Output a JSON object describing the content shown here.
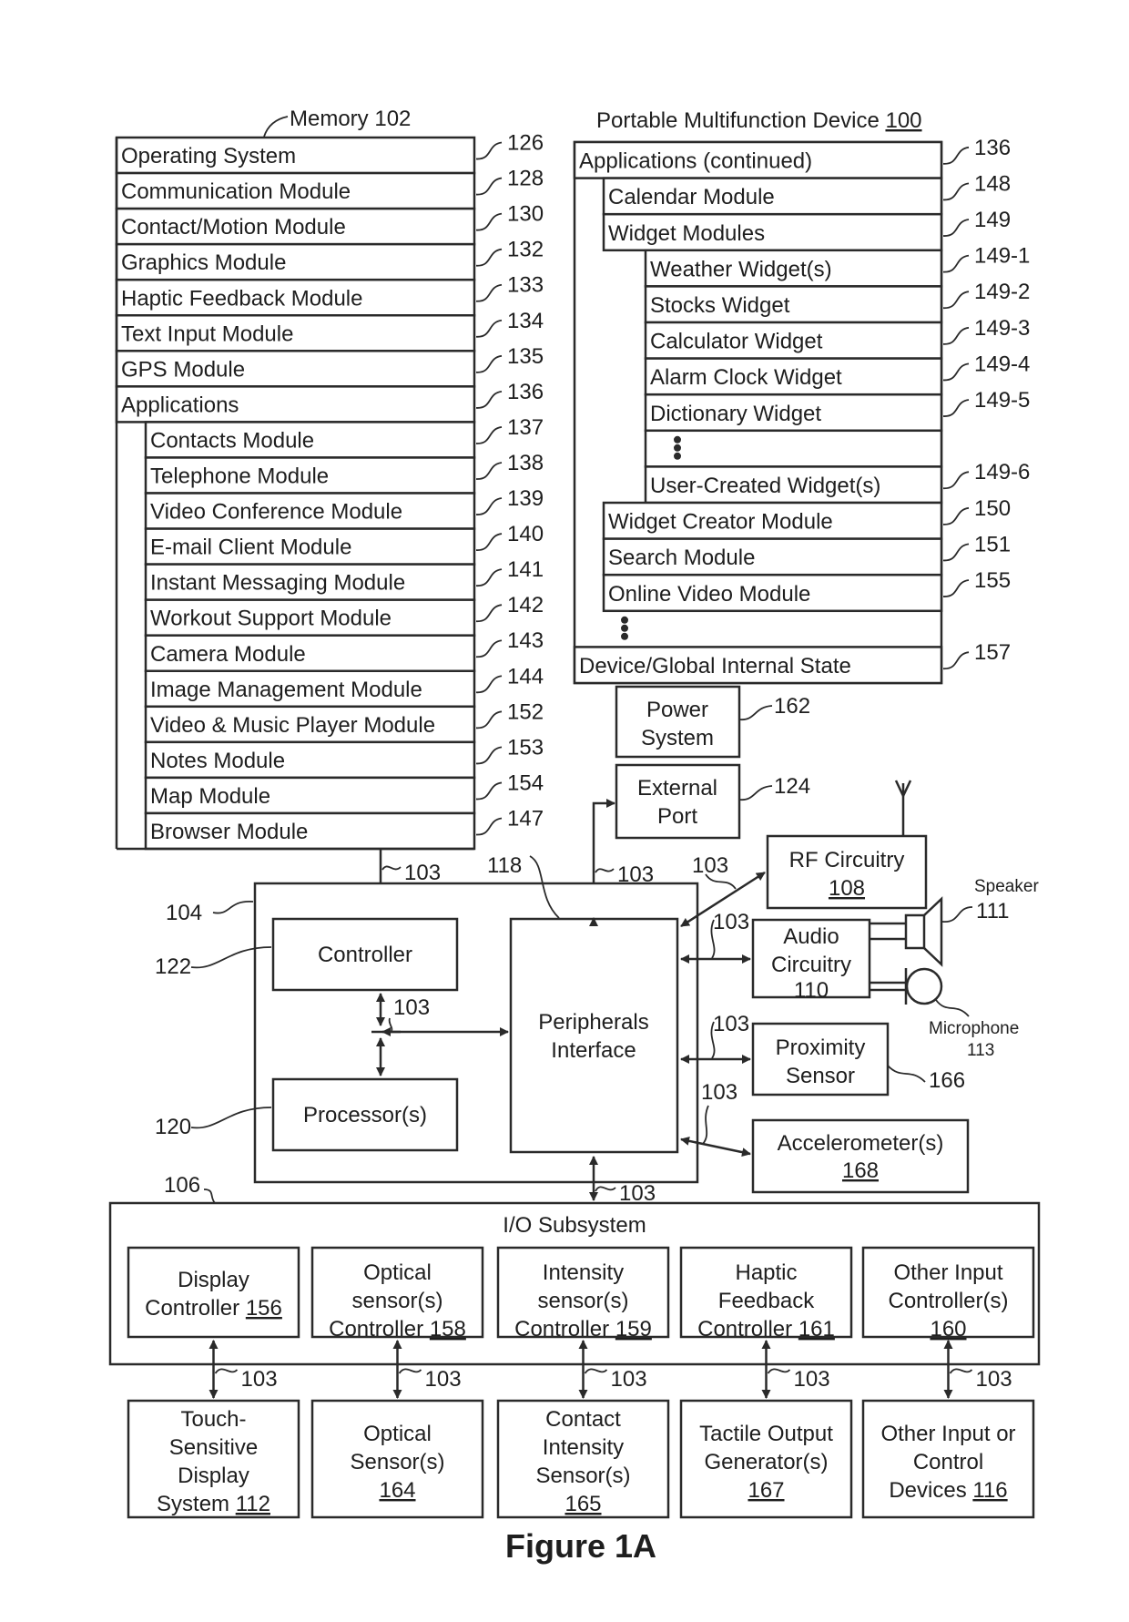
{
  "memory": {
    "label": "Memory 102",
    "rows": [
      {
        "text": "Operating System",
        "ref": "126",
        "indent": 0
      },
      {
        "text": "Communication Module",
        "ref": "128",
        "indent": 0
      },
      {
        "text": "Contact/Motion Module",
        "ref": "130",
        "indent": 0
      },
      {
        "text": "Graphics Module",
        "ref": "132",
        "indent": 0
      },
      {
        "text": "Haptic Feedback Module",
        "ref": "133",
        "indent": 0
      },
      {
        "text": "Text Input Module",
        "ref": "134",
        "indent": 0
      },
      {
        "text": "GPS Module",
        "ref": "135",
        "indent": 0
      },
      {
        "text": "Applications",
        "ref": "136",
        "indent": 0
      },
      {
        "text": "Contacts Module",
        "ref": "137",
        "indent": 1
      },
      {
        "text": "Telephone Module",
        "ref": "138",
        "indent": 1
      },
      {
        "text": "Video Conference Module",
        "ref": "139",
        "indent": 1
      },
      {
        "text": "E-mail Client Module",
        "ref": "140",
        "indent": 1
      },
      {
        "text": "Instant Messaging Module",
        "ref": "141",
        "indent": 1
      },
      {
        "text": "Workout Support Module",
        "ref": "142",
        "indent": 1
      },
      {
        "text": "Camera Module",
        "ref": "143",
        "indent": 1
      },
      {
        "text": "Image Management Module",
        "ref": "144",
        "indent": 1
      },
      {
        "text": "Video & Music Player Module",
        "ref": "152",
        "indent": 1
      },
      {
        "text": "Notes Module",
        "ref": "153",
        "indent": 1
      },
      {
        "text": "Map Module",
        "ref": "154",
        "indent": 1
      },
      {
        "text": "Browser Module",
        "ref": "147",
        "indent": 1
      }
    ]
  },
  "device": {
    "label_prefix": "Portable Multifunction Device ",
    "label_ref": "100",
    "rows": [
      {
        "text": "Applications (continued)",
        "ref": "136",
        "indent": 0
      },
      {
        "text": "Calendar Module",
        "ref": "148",
        "indent": 1
      },
      {
        "text": "Widget Modules",
        "ref": "149",
        "indent": 1
      },
      {
        "text": "Weather Widget(s)",
        "ref": "149-1",
        "indent": 2
      },
      {
        "text": "Stocks Widget",
        "ref": "149-2",
        "indent": 2
      },
      {
        "text": "Calculator Widget",
        "ref": "149-3",
        "indent": 2
      },
      {
        "text": "Alarm Clock Widget",
        "ref": "149-4",
        "indent": 2
      },
      {
        "text": "Dictionary Widget",
        "ref": "149-5",
        "indent": 2
      },
      {
        "text": "",
        "ref": "",
        "indent": 2,
        "ellipsis": true
      },
      {
        "text": "User-Created Widget(s)",
        "ref": "149-6",
        "indent": 2
      },
      {
        "text": "Widget Creator Module",
        "ref": "150",
        "indent": 1
      },
      {
        "text": "Search Module",
        "ref": "151",
        "indent": 1
      },
      {
        "text": "Online Video Module",
        "ref": "155",
        "indent": 1
      },
      {
        "text": "",
        "ref": "",
        "indent": 0,
        "ellipsis": true
      },
      {
        "text": "Device/Global Internal State",
        "ref": "157",
        "indent": 0
      }
    ]
  },
  "power": {
    "line1": "Power",
    "line2": "System",
    "ref": "162"
  },
  "external_port": {
    "line1": "External",
    "line2": "Port",
    "ref": "124"
  },
  "bus_ref": "103",
  "chip": {
    "ref": "104",
    "controller": {
      "text": "Controller",
      "ref": "122"
    },
    "processor": {
      "text": "Processor(s)",
      "ref": "120"
    },
    "peripherals": {
      "line1": "Peripherals",
      "line2": "Interface",
      "ref": "118"
    }
  },
  "rf": {
    "line1": "RF Circuitry",
    "ref": "108"
  },
  "audio": {
    "line1": "Audio",
    "line2": "Circuitry",
    "ref": "110"
  },
  "speaker": {
    "label": "Speaker",
    "ref": "111"
  },
  "microphone": {
    "label": "Microphone",
    "ref": "113"
  },
  "proximity": {
    "line1": "Proximity",
    "line2": "Sensor",
    "ref": "166"
  },
  "accelerometer": {
    "line1": "Accelerometer(s)",
    "ref": "168"
  },
  "io": {
    "label": "I/O Subsystem",
    "ref": "106",
    "controllers": [
      {
        "lines": [
          "Display",
          "Controller "
        ],
        "ref": "156"
      },
      {
        "lines": [
          "Optical",
          "sensor(s)",
          "Controller "
        ],
        "ref": "158"
      },
      {
        "lines": [
          "Intensity",
          "sensor(s)",
          "Controller "
        ],
        "ref": "159"
      },
      {
        "lines": [
          "Haptic",
          "Feedback",
          "Controller "
        ],
        "ref": "161"
      },
      {
        "lines": [
          "Other Input",
          "Controller(s)",
          ""
        ],
        "ref": "160"
      }
    ],
    "devices": [
      {
        "lines": [
          "Touch-",
          "Sensitive",
          "Display",
          "System "
        ],
        "ref": "112"
      },
      {
        "lines": [
          "Optical",
          "Sensor(s)",
          ""
        ],
        "ref": "164"
      },
      {
        "lines": [
          "Contact",
          "Intensity",
          "Sensor(s)",
          ""
        ],
        "ref": "165"
      },
      {
        "lines": [
          "Tactile Output",
          "Generator(s)",
          ""
        ],
        "ref": "167"
      },
      {
        "lines": [
          "Other Input or",
          "Control",
          "Devices "
        ],
        "ref": "116"
      }
    ]
  },
  "figure_label": "Figure 1A"
}
